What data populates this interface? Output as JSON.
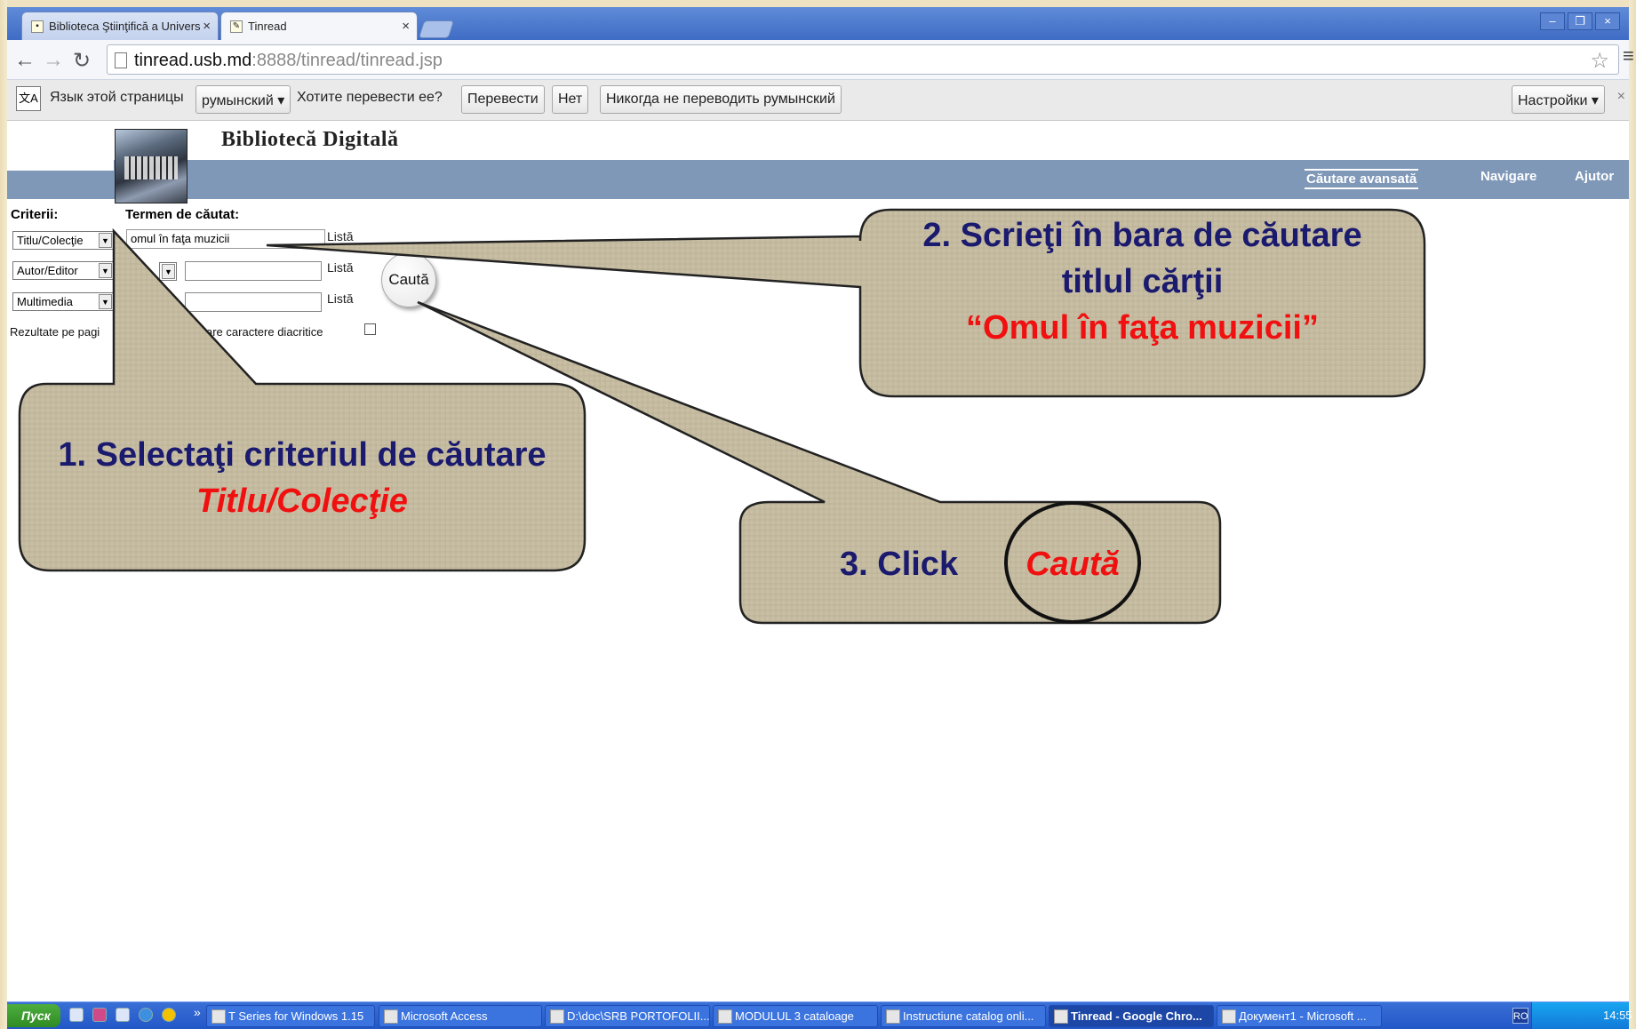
{
  "browser": {
    "tabs": [
      {
        "label": "Biblioteca Ştiinţifică a Univers",
        "active": false
      },
      {
        "label": "Tinread",
        "active": true
      }
    ],
    "url_domain": "tinread.usb.md",
    "url_rest": ":8888/tinread/tinread.jsp",
    "translate_bar": {
      "lang_prompt": "Язык этой страницы",
      "lang_value": "румынский",
      "question": "Хотите перевести ее?",
      "translate_btn": "Перевести",
      "no_btn": "Нет",
      "never_btn": "Никогда не переводить румынский",
      "settings_btn": "Настройки"
    }
  },
  "site": {
    "title": "Bibliotecă Digitală",
    "nav": {
      "advanced": "Căutare avansată",
      "browse": "Navigare",
      "help": "Ajutor"
    }
  },
  "search_form": {
    "criteria_label": "Criterii:",
    "term_label": "Termen de căutat:",
    "rows": [
      {
        "criterion": "Titlu/Colecţie",
        "term": "omul în faţa muzicii",
        "list": "Listă"
      },
      {
        "criterion": "Autor/Editor",
        "term": "",
        "list": "Listă"
      },
      {
        "criterion": "Multimedia",
        "term": "",
        "list": "Listă"
      }
    ],
    "search_button": "Caută",
    "results_label": "Rezultate pe pagi",
    "diacritics_label": "are caractere diacritice"
  },
  "callouts": {
    "step1_line1": "1. Selectaţi criteriul de căutare",
    "step1_line2": "Titlu/Colecţie",
    "step2_line1": "2. Scrieţi în bara de căutare",
    "step2_line2": "titlul cărţii",
    "step2_line3": "“Omul în faţa muzicii”",
    "step3_text": "3. Click",
    "step3_red": "Caută"
  },
  "taskbar": {
    "start": "Пуск",
    "items": [
      {
        "label": "T Series for Windows 1.15",
        "active": false
      },
      {
        "label": "Microsoft Access",
        "active": false
      },
      {
        "label": "D:\\doc\\SRB PORTOFOLII...",
        "active": false
      },
      {
        "label": "MODULUL 3 cataloage",
        "active": false
      },
      {
        "label": "Instructiune catalog onli...",
        "active": false
      },
      {
        "label": "Tinread - Google Chro...",
        "active": true
      },
      {
        "label": "Документ1 - Microsoft ...",
        "active": false
      }
    ],
    "clock": "14:55",
    "lang": "RO"
  },
  "colors": {
    "callout_fill": "#c9bfa6",
    "callout_text": "#1a1a6e",
    "accent_red": "#f01010",
    "nav_strip": "#7f98b8"
  }
}
